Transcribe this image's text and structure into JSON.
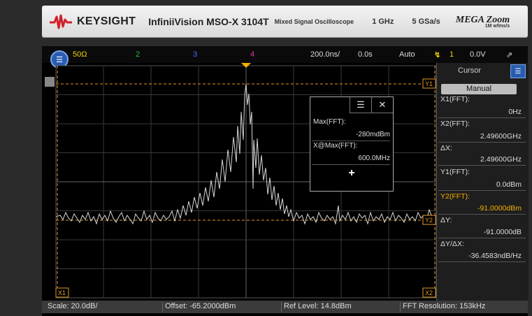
{
  "header": {
    "brand": "KEYSIGHT",
    "model": "InfiniiVision MSO-X 3104T",
    "subtitle": "Mixed Signal Oscilloscope",
    "bandwidth": "1 GHz",
    "sample_rate": "5 GSa/s",
    "mega_zoom": "MEGA Zoom",
    "mega_sub": "1M wfms/s"
  },
  "topbar": {
    "ch1": "50Ω",
    "ch2": "2",
    "ch3": "3",
    "ch4": "4",
    "timebase": "200.0ns/",
    "delay": "0.0s",
    "trigger_mode": "Auto",
    "trigger_source": "1",
    "trigger_level": "0.0V",
    "colors": {
      "ch1": "#f2d200",
      "ch2": "#22c33d",
      "ch3": "#4a6bff",
      "ch4": "#e0389a"
    }
  },
  "graticule": {
    "cursor_y1": "Y1",
    "cursor_y2": "Y2",
    "cursor_x1": "X1",
    "cursor_x2": "X2",
    "cursor_color": "#e39a2a",
    "trace_color": "#d8d8d8"
  },
  "popup": {
    "max_label": "Max(FFT):",
    "max_value": "-280mdBm",
    "xmax_label": "X@Max(FFT):",
    "xmax_value": "600.0MHz",
    "add_glyph": "+"
  },
  "cursor_panel": {
    "title": "Cursor",
    "mode": "Manual",
    "rows": [
      {
        "label": "X1(FFT):",
        "value": "0Hz",
        "highlight": false
      },
      {
        "label": "X2(FFT):",
        "value": "2.49600GHz",
        "highlight": false
      },
      {
        "label": "ΔX:",
        "value": "2.49600GHz",
        "highlight": false
      },
      {
        "label": "Y1(FFT):",
        "value": "0.0dBm",
        "highlight": false
      },
      {
        "label": "Y2(FFT):",
        "value": "-91.0000dBm",
        "highlight": true
      },
      {
        "label": "ΔY:",
        "value": "-91.0000dB",
        "highlight": false
      },
      {
        "label": "ΔY/ΔX:",
        "value": "-36.4583ndB/Hz",
        "highlight": false
      }
    ]
  },
  "bottombar": {
    "scale": "Scale: 20.0dB/",
    "offset": "Offset: -65.2000dBm",
    "ref_level": "Ref Level: 14.8dBm",
    "resolution": "FFT Resolution: 153kHz"
  }
}
